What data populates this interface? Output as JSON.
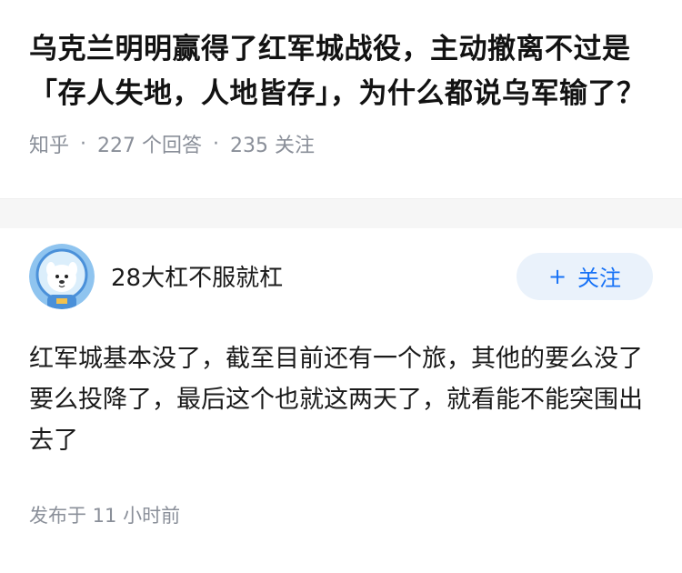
{
  "question": {
    "title": "乌克兰明明赢得了红军城战役，主动撤离不过是「存人失地，人地皆存」，为什么都说乌军输了？",
    "source": "知乎",
    "separator": "·",
    "answers_count": "227 个回答",
    "followers_count": "235 关注"
  },
  "answer": {
    "author_name": "28大杠不服就杠",
    "avatar_icon": "astronaut-dog-avatar",
    "follow_label": "关注",
    "follow_icon": "plus-icon",
    "content": "红军城基本没了，截至目前还有一个旅，其他的要么没了要么投降了，最后这个也就这两天了，就看能不能突围出去了",
    "published": "发布于 11 小时前"
  },
  "colors": {
    "accent": "#1772f6",
    "button_bg": "#eaf2fb",
    "meta_text": "#8a8f99"
  }
}
